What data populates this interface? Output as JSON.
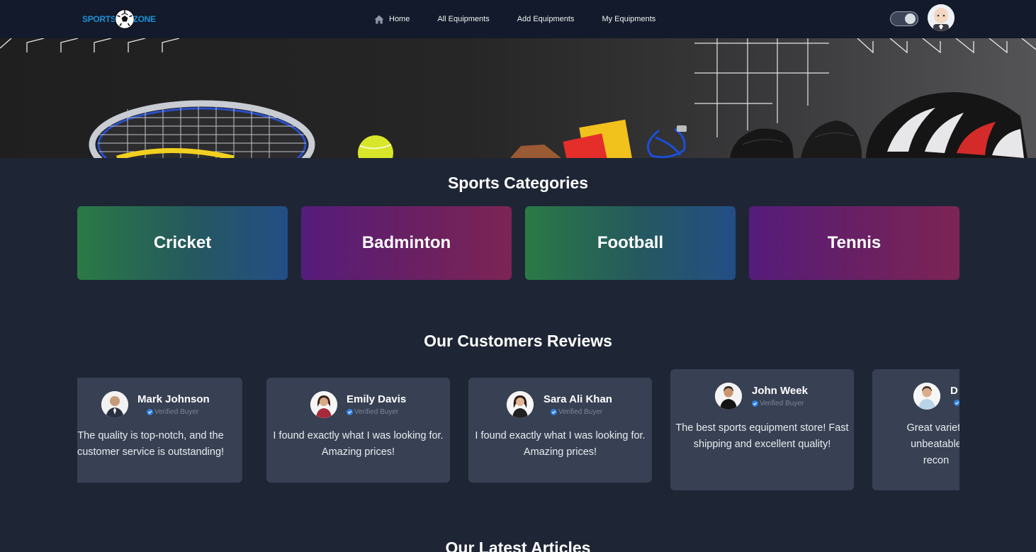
{
  "brand": {
    "part1": "SPORTS",
    "part2": "ZONE"
  },
  "nav": {
    "links": [
      {
        "label": "Home",
        "icon": "home-icon"
      },
      {
        "label": "All Equipments"
      },
      {
        "label": "Add Equipments"
      },
      {
        "label": "My Equipments"
      }
    ],
    "theme_toggle": "on"
  },
  "categories": {
    "title": "Sports Categories",
    "items": [
      {
        "label": "Cricket"
      },
      {
        "label": "Badminton"
      },
      {
        "label": "Football"
      },
      {
        "label": "Tennis"
      }
    ]
  },
  "reviews": {
    "title": "Our Customers Reviews",
    "items": [
      {
        "name": "Mark Johnson",
        "badge": "Verified Buyer",
        "text": "The quality is top-notch, and the customer service is outstanding!"
      },
      {
        "name": "Emily Davis",
        "badge": "Verified Buyer",
        "text": "I found exactly what I was looking for. Amazing prices!"
      },
      {
        "name": "Sara Ali Khan",
        "badge": "Verified Buyer",
        "text": "I found exactly what I was looking for. Amazing prices!"
      },
      {
        "name": "John Week",
        "badge": "Verified Buyer",
        "text": "The best sports equipment store! Fast shipping and excellent quality!"
      },
      {
        "name": "D",
        "badge": "",
        "text": "Great variety unbeatable recon"
      }
    ]
  },
  "articles": {
    "title": "Our Latest Articles"
  },
  "colors": {
    "navbar": "#121a2b",
    "page_bg": "#1e2635",
    "card_bg": "#384153",
    "brand_blue": "#1f8fd6",
    "verified_blue": "#2f7fe0"
  }
}
